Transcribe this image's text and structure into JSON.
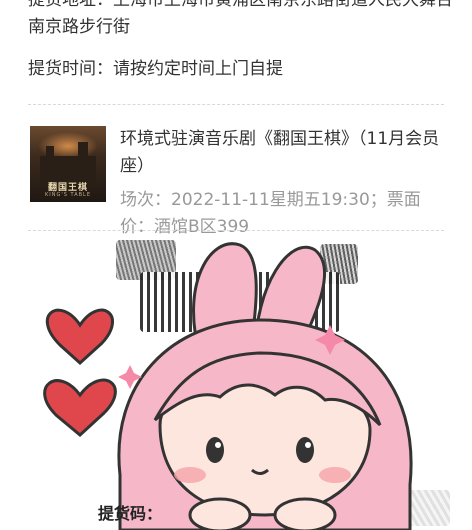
{
  "order": {
    "address_line": "提货地址：上海市上海市黄浦区南京东路街道人民大舞台南京路步行街",
    "pickup_time": "提货时间：请按约定时间上门自提"
  },
  "item": {
    "title": "环境式驻演音乐剧《翻国王棋》（11月会员座）",
    "meta": "场次：2022-11-11星期五19:30；票面价：酒馆B区399",
    "poster_title": "翻国王棋",
    "poster_subtitle": "KING'S TABLE"
  },
  "pickup_code": {
    "label": "提货码："
  },
  "icons": {
    "sticker": "pink-bunny-girl-sticker-icon",
    "hearts": "heart-icon"
  },
  "colors": {
    "text": "#333333",
    "muted": "#999999",
    "divider": "#d9d9d9",
    "heart": "#e0474c",
    "sticker_hair": "#f6b8c8"
  }
}
